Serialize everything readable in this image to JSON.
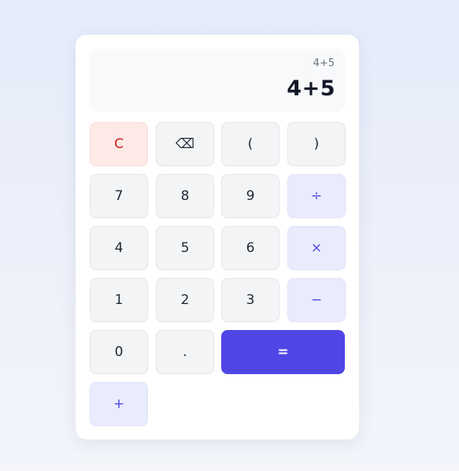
{
  "display": {
    "expression": "4+5",
    "value": "4+5"
  },
  "buttons": {
    "clear": "C",
    "backspace": "⌫",
    "open_paren": "(",
    "close_paren": ")",
    "seven": "7",
    "eight": "8",
    "nine": "9",
    "divide": "÷",
    "four": "4",
    "five": "5",
    "six": "6",
    "multiply": "×",
    "one": "1",
    "two": "2",
    "three": "3",
    "subtract": "−",
    "zero": "0",
    "decimal": ".",
    "equals": "=",
    "add": "+"
  },
  "colors": {
    "accent": "#5046e5",
    "clear_text": "#c81e1e",
    "clear_bg": "#fee9e7",
    "operator_bg": "#e9ecfd"
  }
}
